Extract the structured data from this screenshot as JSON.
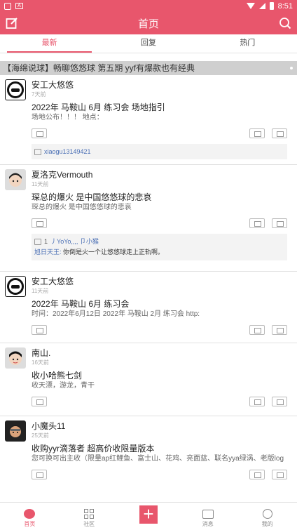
{
  "status_bar": {
    "time": "8:51",
    "notif_letter": "A"
  },
  "app_bar": {
    "title": "首页"
  },
  "tabs": [
    {
      "label": "最新",
      "active": true
    },
    {
      "label": "回复",
      "active": false
    },
    {
      "label": "热门",
      "active": false
    }
  ],
  "banner": {
    "text": "【海绵说球】畅聊悠悠球 第五期 yyf有爆款也有经典"
  },
  "posts": [
    {
      "author": "安工大悠悠",
      "time": "7天前",
      "title": "2022年 马鞍山 6月 练习会 场地指引",
      "text": "场地公布！！！                   地点：",
      "likes_user": "xiaogu13149421"
    },
    {
      "author": "夏洛克Vermouth",
      "time": "11天前",
      "title": "琛总的爆火  是中国悠悠球的悲哀",
      "text": "琛总的爆火  是中国悠悠球的悲哀",
      "likes_count": "1",
      "likes_users": "丿YoYo,,,, 卩小猴",
      "comment_user": "旭日天王:",
      "comment_text": " 你倒是火一个让悠悠球走上正轨啊。"
    },
    {
      "author": "安工大悠悠",
      "time": "11天前",
      "title": "2022年 马鞍山 6月 练习会",
      "text": "时间：2022年6月12日   2022年 马鞍山 2月 练习会  http:"
    },
    {
      "author": "南山.",
      "time": "16天前",
      "title": "收小哈熊七剑",
      "text": "收天漂，游龙，青干"
    },
    {
      "author": "小魔头11",
      "time": "25天前",
      "title": "收购yyr滴落者  超高价收限量版本",
      "text": "您可换可出主收（限量ap红鲤鱼、富士山、花鸡、亮面蓝、联名yya绿涡、老版log"
    }
  ],
  "bottom_nav": [
    {
      "label": "首页",
      "active": true
    },
    {
      "label": "社区",
      "active": false
    },
    {
      "label": "消息",
      "active": false
    },
    {
      "label": "我的",
      "active": false
    }
  ],
  "colors": {
    "brand": "#e8566c",
    "link": "#4a6fb5"
  }
}
